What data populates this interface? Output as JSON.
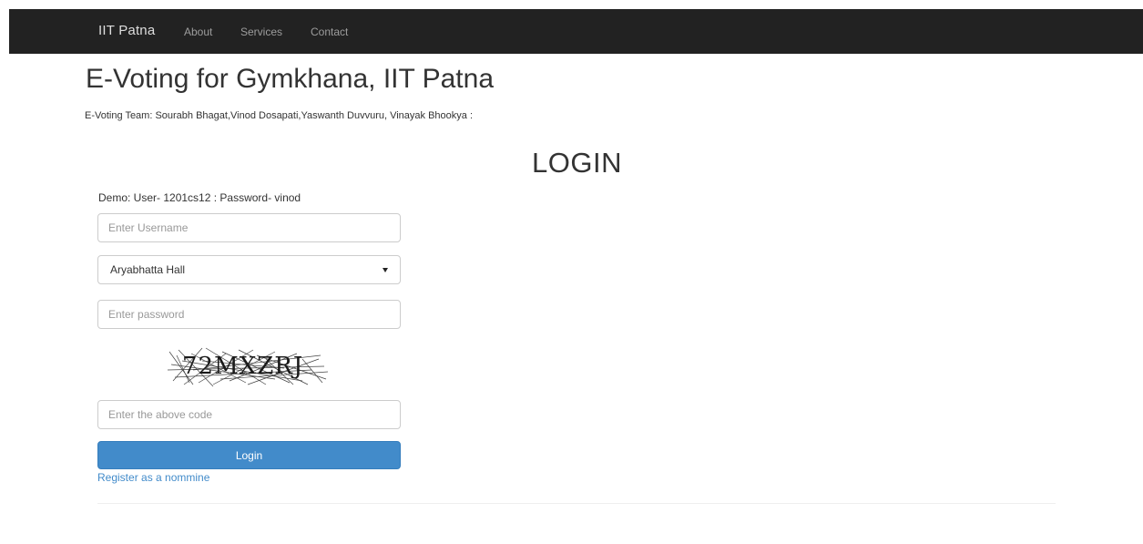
{
  "navbar": {
    "brand": "IIT Patna",
    "links": [
      "About",
      "Services",
      "Contact"
    ]
  },
  "header": {
    "title": "E-Voting for Gymkhana, IIT Patna",
    "team": "E-Voting Team: Sourabh Bhagat,Vinod Dosapati,Yaswanth Duvvuru, Vinayak Bhookya :"
  },
  "login": {
    "heading": "LOGIN",
    "demo": "Demo: User- 1201cs12 : Password- vinod",
    "username_placeholder": "Enter Username",
    "hall_selected": "Aryabhatta Hall",
    "password_placeholder": "Enter password",
    "captcha_text": "72MXZRJ",
    "code_placeholder": "Enter the above code",
    "button_label": "Login",
    "register_link": "Register as a nommine"
  },
  "colors": {
    "navbar_bg": "#222222",
    "primary_button": "#428bca",
    "link": "#428bca"
  },
  "icons": {
    "select_caret": "caret-down-icon"
  }
}
